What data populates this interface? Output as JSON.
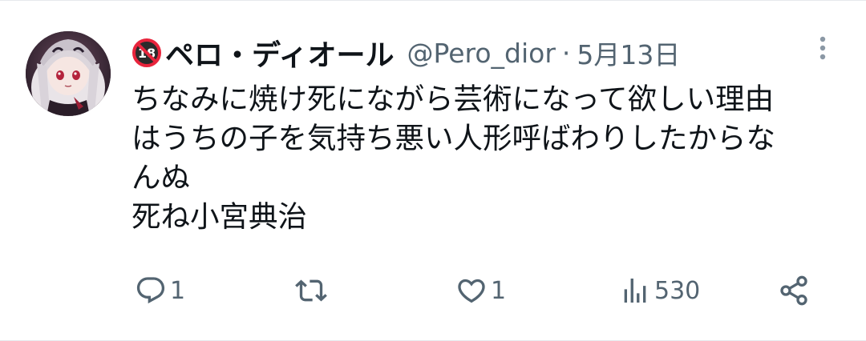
{
  "tweet": {
    "display_name": "ペロ・ディオール",
    "handle": "@Pero_dior",
    "separator": "·",
    "date": "5月13日",
    "text": "ちなみに焼け死にながら芸術になって欲しい理由\nはうちの子を気持ち悪い人形呼ばわりしたからな\nんぬ\n死ね小宮典治",
    "badge_icon": "no-under-18-icon",
    "menu_icon": "more-vertical-icon"
  },
  "actions": {
    "reply": {
      "icon": "reply-icon",
      "count": "1"
    },
    "retweet": {
      "icon": "retweet-icon",
      "count": ""
    },
    "like": {
      "icon": "heart-icon",
      "count": "1"
    },
    "views": {
      "icon": "views-icon",
      "count": "530"
    },
    "share": {
      "icon": "share-icon",
      "count": ""
    }
  },
  "colors": {
    "text_primary": "#0f1419",
    "text_secondary": "#536471",
    "badge_red": "#e8243c",
    "badge_dark": "#2b2b2b"
  }
}
